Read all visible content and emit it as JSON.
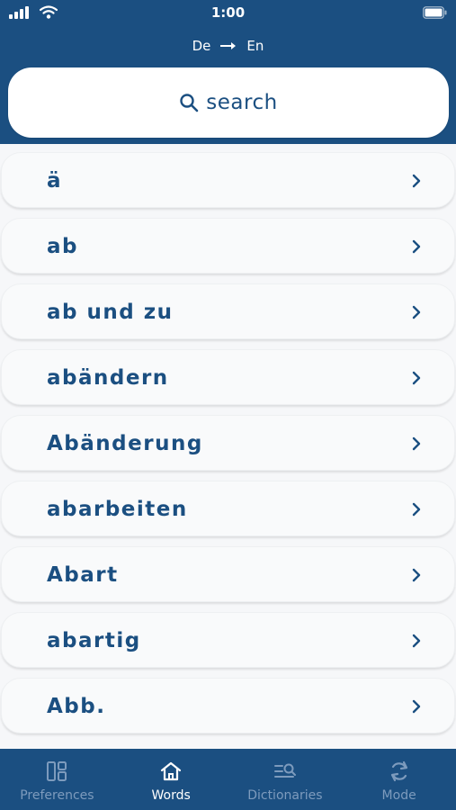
{
  "status_bar": {
    "time": "1:00"
  },
  "header": {
    "source_lang": "De",
    "target_lang": "En"
  },
  "search": {
    "placeholder": "search"
  },
  "words": [
    {
      "label": "ä"
    },
    {
      "label": "ab"
    },
    {
      "label": "ab und zu"
    },
    {
      "label": "abändern"
    },
    {
      "label": "Abänderung"
    },
    {
      "label": "abarbeiten"
    },
    {
      "label": "Abart"
    },
    {
      "label": "abartig"
    },
    {
      "label": "Abb."
    }
  ],
  "tabs": [
    {
      "label": "Preferences",
      "icon": "preferences-icon"
    },
    {
      "label": "Words",
      "icon": "home-icon",
      "active": true
    },
    {
      "label": "Dictionaries",
      "icon": "dictionaries-icon"
    },
    {
      "label": "Mode",
      "icon": "sync-icon"
    }
  ],
  "colors": {
    "primary": "#1b4f81",
    "list_bg": "#f6f7f9",
    "tab_inactive": "#7d9bbd"
  }
}
